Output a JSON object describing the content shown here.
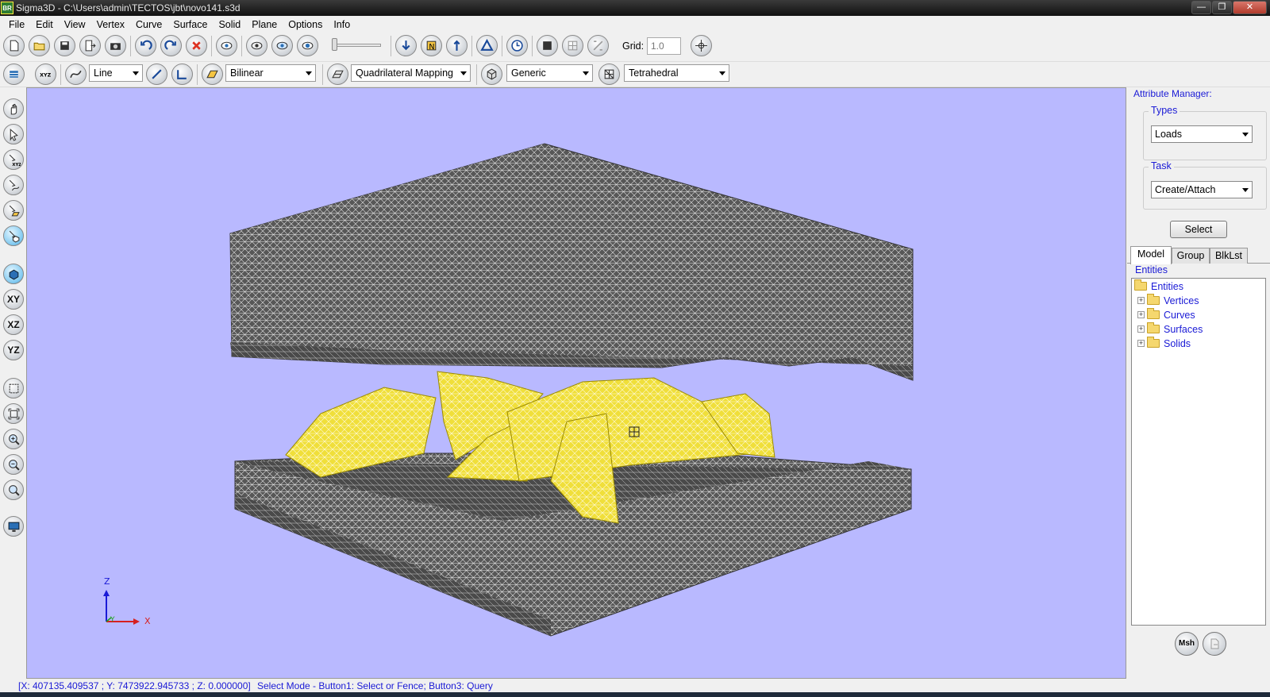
{
  "window": {
    "title": "Sigma3D - C:\\Users\\admin\\TECTOS\\jbt\\novo141.s3d",
    "app_icon_text": "BR"
  },
  "menubar": [
    "File",
    "Edit",
    "View",
    "Vertex",
    "Curve",
    "Surface",
    "Solid",
    "Plane",
    "Options",
    "Info"
  ],
  "toolbar1": {
    "grid_label": "Grid:",
    "grid_value": "1.0"
  },
  "toolbar2": {
    "curve_type": "Line",
    "surface_interp": "Bilinear",
    "mapping": "Quadrilateral Mapping",
    "solid_type": "Generic",
    "mesh_type": "Tetrahedral"
  },
  "lefttoolbar": {
    "xy": "XY",
    "xz": "XZ",
    "yz": "YZ"
  },
  "viewport": {
    "background": "#b9b9ff",
    "axis_labels": {
      "z": "Z",
      "y": "Y",
      "x": "X"
    },
    "mesh_colors": {
      "gray": "#5a5a5a",
      "yellow": "#f0e040"
    }
  },
  "attribute_manager": {
    "title": "Attribute Manager:",
    "types_label": "Types",
    "types_value": "Loads",
    "task_label": "Task",
    "task_value": "Create/Attach",
    "select_label": "Select"
  },
  "tabs": [
    "Model",
    "Group",
    "BlkLst"
  ],
  "entities_label": "Entities",
  "tree": {
    "root": "Entities",
    "children": [
      "Vertices",
      "Curves",
      "Surfaces",
      "Solids"
    ]
  },
  "bottom_buttons": {
    "msh": "Msh"
  },
  "statusbar": {
    "coords": "[X: 407135.409537 ; Y: 7473922.945733 ; Z: 0.000000]",
    "mode": "Select Mode - Button1: Select or Fence; Button3: Query"
  }
}
